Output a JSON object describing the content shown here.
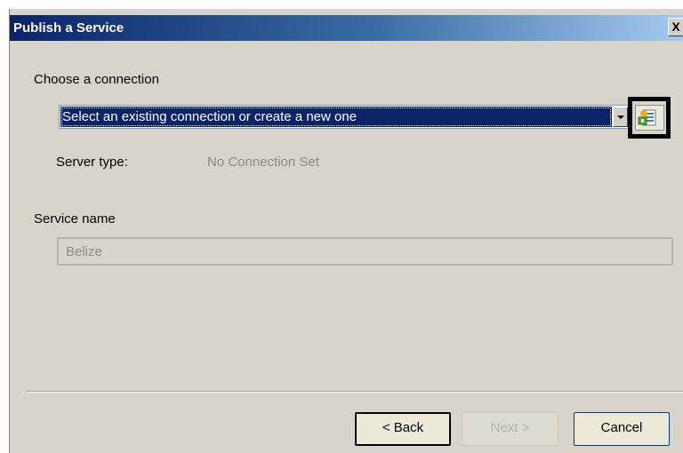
{
  "window": {
    "title": "Publish a Service",
    "close_glyph": "X"
  },
  "connection": {
    "section_label": "Choose a connection",
    "selected_value": "Select an existing connection or create a new one",
    "dropdown_icon": "chevron-down-icon",
    "new_connection_icon": "add-connection-icon",
    "server_type_label": "Server type:",
    "server_type_value": "No Connection Set"
  },
  "service": {
    "section_label": "Service name",
    "value": "Belize"
  },
  "buttons": {
    "back": "< Back",
    "next": "Next >",
    "cancel": "Cancel"
  },
  "colors": {
    "selection": "#0a246a",
    "dialog_bg": "#d8d4cb",
    "disabled_text": "#8c8a84"
  }
}
